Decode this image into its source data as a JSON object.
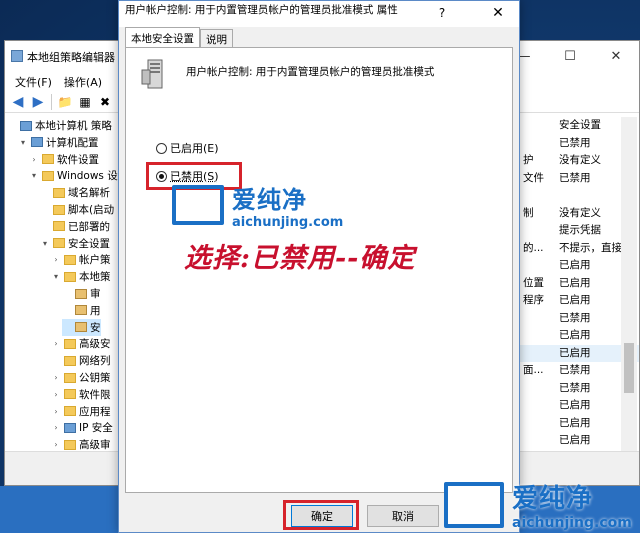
{
  "gpe": {
    "title": "本地组策略编辑器",
    "menu": [
      "文件(F)",
      "操作(A)"
    ],
    "tree": [
      {
        "label": "本地计算机 策略",
        "icon": "pc",
        "level": 0,
        "toggle": ""
      },
      {
        "label": "计算机配置",
        "icon": "pc",
        "level": 1,
        "toggle": "▾"
      },
      {
        "label": "软件设置",
        "icon": "folder",
        "level": 2,
        "toggle": "›"
      },
      {
        "label": "Windows 设",
        "icon": "folder",
        "level": 2,
        "toggle": "▾"
      },
      {
        "label": "域名解析",
        "icon": "folder",
        "level": 3,
        "toggle": ""
      },
      {
        "label": "脚本(启动",
        "icon": "folder",
        "level": 3,
        "toggle": ""
      },
      {
        "label": "已部署的",
        "icon": "folder",
        "level": 3,
        "toggle": ""
      },
      {
        "label": "安全设置",
        "icon": "folder",
        "level": 3,
        "toggle": "▾"
      },
      {
        "label": "帐户策",
        "icon": "folder",
        "level": 4,
        "toggle": "›"
      },
      {
        "label": "本地策",
        "icon": "folder",
        "level": 4,
        "toggle": "▾"
      },
      {
        "label": "审",
        "icon": "lock",
        "level": 5,
        "toggle": ""
      },
      {
        "label": "用",
        "icon": "lock",
        "level": 5,
        "toggle": ""
      },
      {
        "label": "安",
        "icon": "lock",
        "level": 5,
        "toggle": "",
        "selected": true
      },
      {
        "label": "高级安",
        "icon": "folder",
        "level": 4,
        "toggle": "›"
      },
      {
        "label": "网络列",
        "icon": "folder",
        "level": 4,
        "toggle": ""
      },
      {
        "label": "公钥策",
        "icon": "folder",
        "level": 4,
        "toggle": "›"
      },
      {
        "label": "软件限",
        "icon": "folder",
        "level": 4,
        "toggle": "›"
      },
      {
        "label": "应用程",
        "icon": "folder",
        "level": 4,
        "toggle": "›"
      },
      {
        "label": "IP 安全",
        "icon": "shield",
        "level": 4,
        "toggle": "›"
      },
      {
        "label": "高级审",
        "icon": "folder",
        "level": 4,
        "toggle": "›"
      }
    ],
    "rows": [
      {
        "a": "",
        "b": "安全设置"
      },
      {
        "a": "",
        "b": "已禁用"
      },
      {
        "a": "护",
        "b": "没有定义"
      },
      {
        "a": "文件",
        "b": "已禁用"
      },
      {
        "a": "",
        "b": ""
      },
      {
        "a": "制",
        "b": "没有定义"
      },
      {
        "a": "",
        "b": "提示凭据"
      },
      {
        "a": "的...",
        "b": "不提示，直接"
      },
      {
        "a": "",
        "b": "已启用"
      },
      {
        "a": "位置",
        "b": "已启用"
      },
      {
        "a": "程序",
        "b": "已启用"
      },
      {
        "a": "",
        "b": "已禁用"
      },
      {
        "a": "",
        "b": "已启用"
      },
      {
        "a": "",
        "b": "已启用"
      },
      {
        "a": "面...",
        "b": "已禁用"
      },
      {
        "a": "",
        "b": "已禁用"
      },
      {
        "a": "",
        "b": "已启用"
      },
      {
        "a": "",
        "b": "已启用"
      },
      {
        "a": "",
        "b": "已启用"
      }
    ]
  },
  "dialog": {
    "title": "用户帐户控制: 用于内置管理员帐户的管理员批准模式 属性",
    "help": "?",
    "close": "✕",
    "tabs": [
      "本地安全设置",
      "说明"
    ],
    "description": "用户帐户控制: 用于内置管理员帐户的管理员批准模式",
    "options": [
      "已启用(E)",
      "已禁用(S)"
    ],
    "selected": 1,
    "ok": "确定",
    "cancel": "取消"
  },
  "annotation": "选择:已禁用--确定",
  "watermark": {
    "name": "爱纯净",
    "url": "aichunjing.com"
  },
  "colors": {
    "highlight": "#d6232b",
    "accent": "#1a6fc5"
  }
}
